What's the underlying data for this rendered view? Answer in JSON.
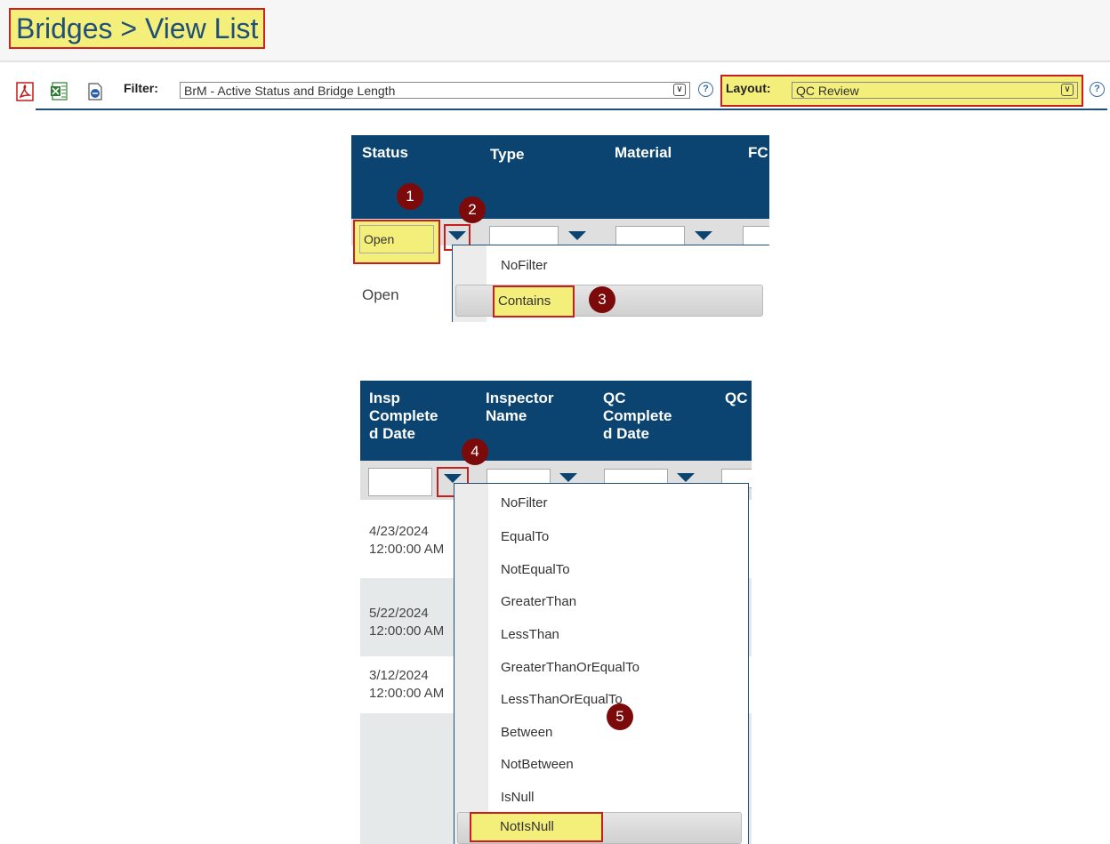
{
  "header": {
    "title": "Bridges > View List"
  },
  "toolbar": {
    "icons": [
      "pdf-icon",
      "excel-icon",
      "report-icon"
    ],
    "filter_label": "Filter:",
    "filter_value": "BrM - Active Status and Bridge Length",
    "layout_label": "Layout:",
    "layout_value": "QC Review",
    "help_glyph": "?"
  },
  "panel1": {
    "columns": [
      "Status",
      "Type",
      "Material",
      "FC"
    ],
    "status_filter_value": "Open",
    "row_value": "Open",
    "menu": [
      "NoFilter",
      "Contains"
    ],
    "selected": "Contains"
  },
  "panel2": {
    "columns": [
      "Insp Complete d Date",
      "Inspector Name",
      "QC Complete d Date",
      "QC"
    ],
    "col_lines": [
      [
        "Insp",
        "Complete",
        "d Date"
      ],
      [
        "Inspector",
        "Name"
      ],
      [
        "QC",
        "Complete",
        "d Date"
      ],
      [
        "QC"
      ]
    ],
    "rows": [
      {
        "date": "4/23/2024",
        "time": "12:00:00 AM"
      },
      {
        "date": "5/22/2024",
        "time": "12:00:00 AM"
      },
      {
        "date": "3/12/2024",
        "time": "12:00:00 AM"
      }
    ],
    "menu": [
      "NoFilter",
      "EqualTo",
      "NotEqualTo",
      "GreaterThan",
      "LessThan",
      "GreaterThanOrEqualTo",
      "LessThanOrEqualTo",
      "Between",
      "NotBetween",
      "IsNull",
      "NotIsNull"
    ],
    "selected": "NotIsNull"
  },
  "badges": [
    "1",
    "2",
    "3",
    "4",
    "5"
  ],
  "colors": {
    "header_bg": "#0b4470",
    "highlight": "#f4ef7a",
    "outline": "#c81e1e",
    "badge": "#7c0a0a"
  }
}
